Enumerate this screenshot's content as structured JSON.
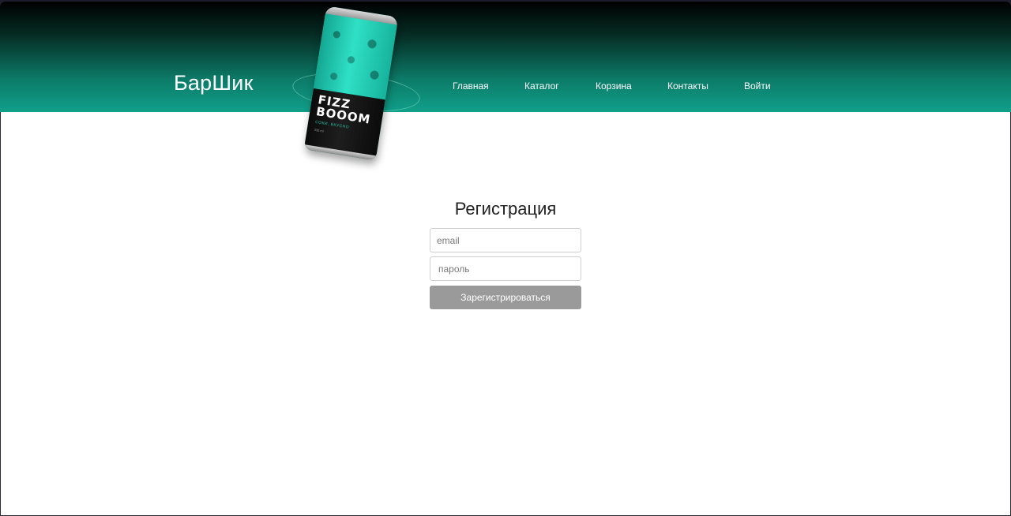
{
  "header": {
    "logo": "БарШик",
    "nav": [
      {
        "label": "Главная"
      },
      {
        "label": "Каталог"
      },
      {
        "label": "Корзина"
      },
      {
        "label": "Контакты"
      },
      {
        "label": "Войти"
      }
    ]
  },
  "hero_can": {
    "title_line1": "FIZZ",
    "title_line2": "BOOOM",
    "subtitle": "СОКИ, ВКУСНО",
    "volume": "330 ml"
  },
  "registration": {
    "title": "Регистрация",
    "email_placeholder": "email",
    "password_placeholder": "пароль",
    "submit_label": "Зарегистрироваться"
  }
}
